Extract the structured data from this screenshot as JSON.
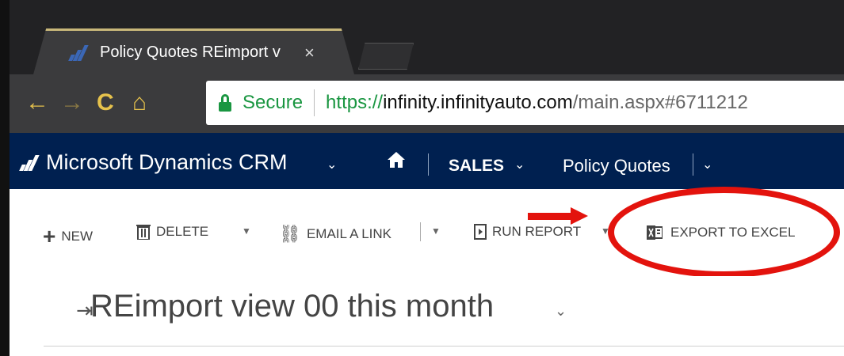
{
  "browser": {
    "tab": {
      "title": "Policy Quotes REimport v",
      "close": "×"
    },
    "nav": {
      "back": "←",
      "forward": "→",
      "reload": "C",
      "home": "⌂"
    },
    "address": {
      "secure_label": "Secure",
      "url_scheme": "https://",
      "url_host": "infinity.infinityauto.com",
      "url_path": "/main.aspx#6711212"
    }
  },
  "crm": {
    "app_title": "Microsoft Dynamics CRM",
    "area": "SALES",
    "entity": "Policy Quotes",
    "chevron": "⌄"
  },
  "commands": {
    "new": "NEW",
    "delete": "DELETE",
    "email_link": "EMAIL A LINK",
    "run_report": "RUN REPORT",
    "export_excel": "EXPORT TO EXCEL",
    "drop": "▼"
  },
  "view": {
    "title": "REimport view 00 this month",
    "chevron": "⌄"
  },
  "colors": {
    "accent_gold": "#e6c24c",
    "secure_green": "#1a9641",
    "crm_navy": "#002050",
    "annotation_red": "#e3130d"
  }
}
